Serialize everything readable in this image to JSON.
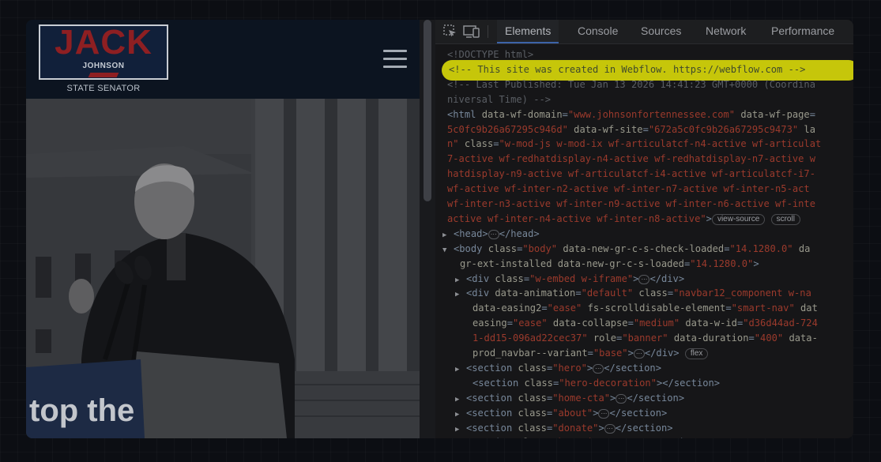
{
  "site": {
    "logo": {
      "name": "JACK",
      "surname": "JOHNSON",
      "title": "STATE SENATOR"
    },
    "photo_sign_text": "top the"
  },
  "devtools": {
    "tabs": [
      {
        "label": "Elements",
        "active": true
      },
      {
        "label": "Console",
        "active": false
      },
      {
        "label": "Sources",
        "active": false
      },
      {
        "label": "Network",
        "active": false
      },
      {
        "label": "Performance",
        "active": false
      }
    ],
    "lines": [
      {
        "indent": 0,
        "arrow": "",
        "segments": [
          {
            "t": "<!DOCTYPE html>",
            "c": "cmt"
          }
        ]
      },
      {
        "indent": 0,
        "arrow": "",
        "highlight": true,
        "segments": [
          {
            "t": "<!-- This site was created in Webflow. https://webflow.com --> ",
            "c": "hl"
          }
        ]
      },
      {
        "indent": 0,
        "arrow": "",
        "segments": [
          {
            "t": "<!-- Last Published: Tue Jan 13 2026 14:41:23 GMT+0000 (Coordina",
            "c": "cmt"
          }
        ]
      },
      {
        "indent": 0,
        "arrow": "",
        "segments": [
          {
            "t": "niversal Time) -->",
            "c": "cmt"
          }
        ]
      },
      {
        "indent": 0,
        "arrow": "",
        "segments": [
          {
            "t": "<html ",
            "c": "tag"
          },
          {
            "t": "data-wf-domain",
            "c": "attr"
          },
          {
            "t": "=",
            "c": "tag"
          },
          {
            "t": "\"www.johnsonfortennessee.com\"",
            "c": "val"
          },
          {
            "t": " data-wf-page",
            "c": "attr"
          },
          {
            "t": "=",
            "c": "tag"
          }
        ]
      },
      {
        "indent": 0,
        "arrow": "",
        "segments": [
          {
            "t": "5c0fc9b26a67295c946d\"",
            "c": "val"
          },
          {
            "t": " data-wf-site",
            "c": "attr"
          },
          {
            "t": "=",
            "c": "tag"
          },
          {
            "t": "\"672a5c0fc9b26a67295c9473\"",
            "c": "val"
          },
          {
            "t": " la",
            "c": "attr"
          }
        ]
      },
      {
        "indent": 0,
        "arrow": "",
        "segments": [
          {
            "t": "n\"",
            "c": "val"
          },
          {
            "t": " class",
            "c": "attr"
          },
          {
            "t": "=",
            "c": "tag"
          },
          {
            "t": "\"w-mod-js w-mod-ix wf-articulatcf-n4-active wf-articulat",
            "c": "val"
          }
        ]
      },
      {
        "indent": 0,
        "arrow": "",
        "segments": [
          {
            "t": "7-active wf-redhatdisplay-n4-active wf-redhatdisplay-n7-active w",
            "c": "val"
          }
        ]
      },
      {
        "indent": 0,
        "arrow": "",
        "segments": [
          {
            "t": "hatdisplay-n9-active wf-articulatcf-i4-active wf-articulatcf-i7-",
            "c": "val"
          }
        ]
      },
      {
        "indent": 0,
        "arrow": "",
        "segments": [
          {
            "t": "wf-active wf-inter-n2-active wf-inter-n7-active wf-inter-n5-act",
            "c": "val"
          }
        ]
      },
      {
        "indent": 0,
        "arrow": "",
        "segments": [
          {
            "t": "wf-inter-n3-active wf-inter-n9-active wf-inter-n6-active wf-inte",
            "c": "val"
          }
        ]
      },
      {
        "indent": 0,
        "arrow": "",
        "segments": [
          {
            "t": "active wf-inter-n4-active wf-inter-n8-active\"",
            "c": "val"
          },
          {
            "t": ">",
            "c": "tag"
          },
          {
            "t": "view-source",
            "c": "pill"
          },
          {
            "t": " ",
            "c": "tag"
          },
          {
            "t": "scroll",
            "c": "pill"
          }
        ]
      },
      {
        "indent": 8,
        "arrow": "▶",
        "segments": [
          {
            "t": "<head>",
            "c": "tag"
          },
          {
            "t": "···",
            "c": "dots"
          },
          {
            "t": "</head>",
            "c": "tag"
          }
        ]
      },
      {
        "indent": 8,
        "arrow": "▼",
        "segments": [
          {
            "t": "<body ",
            "c": "tag"
          },
          {
            "t": "class",
            "c": "attr"
          },
          {
            "t": "=",
            "c": "tag"
          },
          {
            "t": "\"body\"",
            "c": "val"
          },
          {
            "t": " data-new-gr-c-s-check-loaded",
            "c": "attr"
          },
          {
            "t": "=",
            "c": "tag"
          },
          {
            "t": "\"14.1280.0\"",
            "c": "val"
          },
          {
            "t": " da",
            "c": "attr"
          }
        ]
      },
      {
        "indent": 16,
        "arrow": "",
        "segments": [
          {
            "t": "gr-ext-installed data-new-gr-c-s-loaded",
            "c": "attr"
          },
          {
            "t": "=",
            "c": "tag"
          },
          {
            "t": "\"14.1280.0\"",
            "c": "val"
          },
          {
            "t": ">",
            "c": "tag"
          }
        ]
      },
      {
        "indent": 24,
        "arrow": "▶",
        "segments": [
          {
            "t": "<div ",
            "c": "tag"
          },
          {
            "t": "class",
            "c": "attr"
          },
          {
            "t": "=",
            "c": "tag"
          },
          {
            "t": "\"w-embed w-iframe\"",
            "c": "val"
          },
          {
            "t": ">",
            "c": "tag"
          },
          {
            "t": "···",
            "c": "dots"
          },
          {
            "t": "</div>",
            "c": "tag"
          }
        ]
      },
      {
        "indent": 24,
        "arrow": "▶",
        "segments": [
          {
            "t": "<div ",
            "c": "tag"
          },
          {
            "t": "data-animation",
            "c": "attr"
          },
          {
            "t": "=",
            "c": "tag"
          },
          {
            "t": "\"default\"",
            "c": "val"
          },
          {
            "t": " class",
            "c": "attr"
          },
          {
            "t": "=",
            "c": "tag"
          },
          {
            "t": "\"navbar12_component w-na",
            "c": "val"
          }
        ]
      },
      {
        "indent": 32,
        "arrow": "",
        "segments": [
          {
            "t": "data-easing2",
            "c": "attr"
          },
          {
            "t": "=",
            "c": "tag"
          },
          {
            "t": "\"ease\"",
            "c": "val"
          },
          {
            "t": " fs-scrolldisable-element",
            "c": "attr"
          },
          {
            "t": "=",
            "c": "tag"
          },
          {
            "t": "\"smart-nav\"",
            "c": "val"
          },
          {
            "t": " dat",
            "c": "attr"
          }
        ]
      },
      {
        "indent": 32,
        "arrow": "",
        "segments": [
          {
            "t": "easing",
            "c": "attr"
          },
          {
            "t": "=",
            "c": "tag"
          },
          {
            "t": "\"ease\"",
            "c": "val"
          },
          {
            "t": " data-collapse",
            "c": "attr"
          },
          {
            "t": "=",
            "c": "tag"
          },
          {
            "t": "\"medium\"",
            "c": "val"
          },
          {
            "t": " data-w-id",
            "c": "attr"
          },
          {
            "t": "=",
            "c": "tag"
          },
          {
            "t": "\"d36d44ad-724",
            "c": "val"
          }
        ]
      },
      {
        "indent": 32,
        "arrow": "",
        "segments": [
          {
            "t": "1-dd15-096ad22cec37\"",
            "c": "val"
          },
          {
            "t": " role",
            "c": "attr"
          },
          {
            "t": "=",
            "c": "tag"
          },
          {
            "t": "\"banner\"",
            "c": "val"
          },
          {
            "t": " data-duration",
            "c": "attr"
          },
          {
            "t": "=",
            "c": "tag"
          },
          {
            "t": "\"400\"",
            "c": "val"
          },
          {
            "t": " data-",
            "c": "attr"
          }
        ]
      },
      {
        "indent": 32,
        "arrow": "",
        "segments": [
          {
            "t": "prod_navbar--variant",
            "c": "attr"
          },
          {
            "t": "=",
            "c": "tag"
          },
          {
            "t": "\"base\"",
            "c": "val"
          },
          {
            "t": ">",
            "c": "tag"
          },
          {
            "t": "···",
            "c": "dots"
          },
          {
            "t": "</div>",
            "c": "tag"
          },
          {
            "t": " ",
            "c": "tag"
          },
          {
            "t": "flex",
            "c": "pill"
          }
        ]
      },
      {
        "indent": 24,
        "arrow": "▶",
        "segments": [
          {
            "t": "<section ",
            "c": "tag"
          },
          {
            "t": "class",
            "c": "attr"
          },
          {
            "t": "=",
            "c": "tag"
          },
          {
            "t": "\"hero\"",
            "c": "val"
          },
          {
            "t": ">",
            "c": "tag"
          },
          {
            "t": "···",
            "c": "dots"
          },
          {
            "t": "</section>",
            "c": "tag"
          }
        ]
      },
      {
        "indent": 32,
        "arrow": "",
        "segments": [
          {
            "t": "<section ",
            "c": "tag"
          },
          {
            "t": "class",
            "c": "attr"
          },
          {
            "t": "=",
            "c": "tag"
          },
          {
            "t": "\"hero-decoration\"",
            "c": "val"
          },
          {
            "t": "></section>",
            "c": "tag"
          }
        ]
      },
      {
        "indent": 24,
        "arrow": "▶",
        "segments": [
          {
            "t": "<section ",
            "c": "tag"
          },
          {
            "t": "class",
            "c": "attr"
          },
          {
            "t": "=",
            "c": "tag"
          },
          {
            "t": "\"home-cta\"",
            "c": "val"
          },
          {
            "t": ">",
            "c": "tag"
          },
          {
            "t": "···",
            "c": "dots"
          },
          {
            "t": "</section>",
            "c": "tag"
          }
        ]
      },
      {
        "indent": 24,
        "arrow": "▶",
        "segments": [
          {
            "t": "<section ",
            "c": "tag"
          },
          {
            "t": "class",
            "c": "attr"
          },
          {
            "t": "=",
            "c": "tag"
          },
          {
            "t": "\"about\"",
            "c": "val"
          },
          {
            "t": ">",
            "c": "tag"
          },
          {
            "t": "···",
            "c": "dots"
          },
          {
            "t": "</section>",
            "c": "tag"
          }
        ]
      },
      {
        "indent": 24,
        "arrow": "▶",
        "segments": [
          {
            "t": "<section ",
            "c": "tag"
          },
          {
            "t": "class",
            "c": "attr"
          },
          {
            "t": "=",
            "c": "tag"
          },
          {
            "t": "\"donate\"",
            "c": "val"
          },
          {
            "t": ">",
            "c": "tag"
          },
          {
            "t": "···",
            "c": "dots"
          },
          {
            "t": "</section>",
            "c": "tag"
          }
        ]
      },
      {
        "indent": 24,
        "arrow": "▶",
        "segments": [
          {
            "t": "<section ",
            "c": "tag"
          },
          {
            "t": "class",
            "c": "attr"
          },
          {
            "t": "=",
            "c": "tag"
          },
          {
            "t": "\"home-issues\"",
            "c": "val"
          },
          {
            "t": ">",
            "c": "tag"
          },
          {
            "t": "···",
            "c": "dots"
          },
          {
            "t": "</section>",
            "c": "tag"
          }
        ]
      }
    ]
  }
}
